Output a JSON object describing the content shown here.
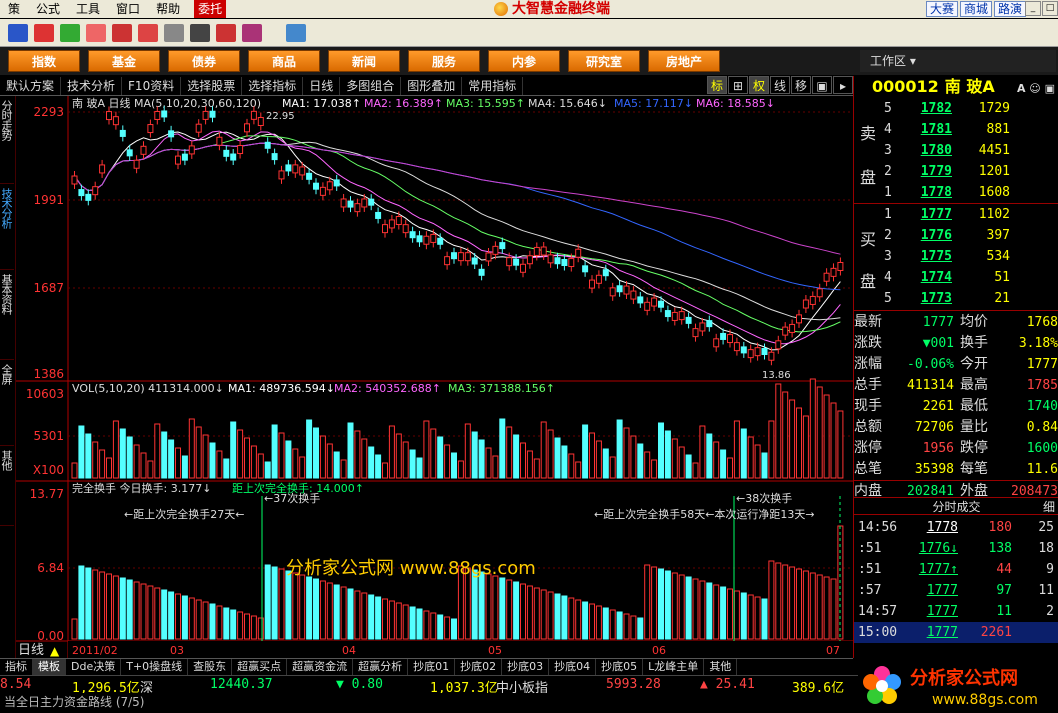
{
  "menu": [
    "策",
    "公式",
    "工具",
    "窗口",
    "帮助",
    "委托"
  ],
  "app_title": "大智慧金融终端",
  "top_right": [
    "大赛",
    "商城",
    "路演"
  ],
  "nav": [
    "指数",
    "基金",
    "债券",
    "商品",
    "新闻",
    "服务",
    "内参",
    "研究室",
    "房地产"
  ],
  "workarea": "工作区",
  "tabs": [
    "默认方案",
    "技术分析",
    "F10资料",
    "选择股票",
    "选择指标",
    "日线",
    "多图组合",
    "图形叠加",
    "常用指标"
  ],
  "tab_right": [
    "标",
    "⊞",
    "权",
    "线",
    "移",
    "▣",
    "▸"
  ],
  "left_tabs": [
    "分时走势",
    "技术分析",
    "基本资料",
    "全屏",
    "其他"
  ],
  "chart": {
    "header": "南  玻A 日线  MA(5,10,20,30,60,120)",
    "ma1": "MA1: 17.038↑",
    "ma2": "MA2: 16.389↑",
    "ma3": "MA3: 15.595↑",
    "ma4": "MA4: 15.646↓",
    "ma5": "MA5: 17.117↓",
    "ma6": "MA6: 18.585↓",
    "hi_label": "22.95",
    "lo_label": "13.86",
    "y_labels": [
      "2293",
      "1991",
      "1687",
      "1386"
    ],
    "vol_header": "VOL(5,10,20)  411314.000↓",
    "vol_ma1": "MA1: 489736.594↓",
    "vol_ma2": "MA2: 540352.688↑",
    "vol_ma3": "MA3: 371388.156↑",
    "vol_y": [
      "10603",
      "5301",
      "X100"
    ],
    "hs_header": "完全换手  今日换手: 3.177↓",
    "hs_last": "距上次完全换手: 14.000↑",
    "hs_y": [
      "13.77",
      "6.84",
      "0.00"
    ],
    "ann1": "←距上次完全换手27天←",
    "ann2": "←37次换手",
    "ann3": "←38次换手",
    "ann4": "←距上次完全换手58天←本次运行净距13天→",
    "watermark": "分析家公式网  www.88gs.com",
    "x_labels": [
      "2011/02",
      "03",
      "04",
      "05",
      "06",
      "07"
    ],
    "footer": "日线"
  },
  "chart_data": {
    "type": "candlestick",
    "title": "南玻A 日线",
    "ylim": [
      13.86,
      22.93
    ],
    "ma_last": {
      "MA1": 17.038,
      "MA2": 16.389,
      "MA3": 15.595,
      "MA4": 15.646,
      "MA5": 17.117,
      "MA6": 18.585
    },
    "high": 22.95,
    "low": 13.86,
    "volume_last": 411314.0,
    "turnover_last": 3.177,
    "days_since_full_turnover": 14
  },
  "right": {
    "code": "000012",
    "name": "南  玻A",
    "sell_label": "卖盘",
    "buy_label": "买盘",
    "sell": [
      {
        "lv": "5",
        "price": "1782",
        "vol": "1729"
      },
      {
        "lv": "4",
        "price": "1781",
        "vol": "881"
      },
      {
        "lv": "3",
        "price": "1780",
        "vol": "4451"
      },
      {
        "lv": "2",
        "price": "1779",
        "vol": "1201"
      },
      {
        "lv": "1",
        "price": "1778",
        "vol": "1608"
      }
    ],
    "buy": [
      {
        "lv": "1",
        "price": "1777",
        "vol": "1102"
      },
      {
        "lv": "2",
        "price": "1776",
        "vol": "397"
      },
      {
        "lv": "3",
        "price": "1775",
        "vol": "534"
      },
      {
        "lv": "4",
        "price": "1774",
        "vol": "51"
      },
      {
        "lv": "5",
        "price": "1773",
        "vol": "21"
      }
    ],
    "quote": [
      {
        "l1": "最新",
        "v1": "1777",
        "c1": "#00ff66",
        "l2": "均价",
        "v2": "1768",
        "c2": "#ffff00"
      },
      {
        "l1": "涨跌",
        "v1": "▼001",
        "c1": "#00ff66",
        "l2": "换手",
        "v2": "3.18%",
        "c2": "#ffff00"
      },
      {
        "l1": "涨幅",
        "v1": "-0.06%",
        "c1": "#00ff66",
        "l2": "今开",
        "v2": "1777",
        "c2": "#ffff00"
      },
      {
        "l1": "总手",
        "v1": "411314",
        "c1": "#ffff00",
        "l2": "最高",
        "v2": "1785",
        "c2": "#ff4444"
      },
      {
        "l1": "现手",
        "v1": "2261",
        "c1": "#ffff00",
        "l2": "最低",
        "v2": "1740",
        "c2": "#00ff66"
      },
      {
        "l1": "总额",
        "v1": "72706",
        "c1": "#ffff00",
        "l2": "量比",
        "v2": "0.84",
        "c2": "#ffff00"
      },
      {
        "l1": "涨停",
        "v1": "1956",
        "c1": "#ff4444",
        "l2": "跌停",
        "v2": "1600",
        "c2": "#00ff66"
      },
      {
        "l1": "总笔",
        "v1": "35398",
        "c1": "#ffff00",
        "l2": "每笔",
        "v2": "11.6",
        "c2": "#ffff00"
      },
      {
        "l1": "内盘",
        "v1": "202841",
        "c1": "#00ff66",
        "l2": "外盘",
        "v2": "208473",
        "c2": "#ff4444"
      }
    ],
    "ticks_title": "分时成交",
    "ticks_tab": "细",
    "ticks": [
      {
        "t": "14:56",
        "p": "1778",
        "pc": "#ffffff",
        "v": "180",
        "vc": "#ff4444",
        "n": "25"
      },
      {
        "t": ":51",
        "p": "1776↓",
        "pc": "#00ff66",
        "v": "138",
        "vc": "#00ff66",
        "n": "18"
      },
      {
        "t": ":51",
        "p": "1777↑",
        "pc": "#00ff66",
        "v": "44",
        "vc": "#ff4444",
        "n": "9"
      },
      {
        "t": ":57",
        "p": "1777",
        "pc": "#00ff66",
        "v": "97",
        "vc": "#00ff66",
        "n": "11"
      },
      {
        "t": "14:57",
        "p": "1777",
        "pc": "#00ff66",
        "v": "11",
        "vc": "#00ff66",
        "n": "2"
      },
      {
        "t": "15:00",
        "p": "1777",
        "pc": "#00ff66",
        "v": "2261",
        "vc": "#ff4444",
        "n": ""
      }
    ]
  },
  "bottom_tabs": [
    "指标",
    "模板",
    "Dde决策",
    "T+0操盘线",
    "查股东",
    "超赢买点",
    "超赢资金流",
    "超赢分析",
    "抄底01",
    "抄底02",
    "抄底03",
    "抄底04",
    "抄底05",
    "L龙峰主单",
    "其他"
  ],
  "status": {
    "s1": "8.54",
    "s2": "1,296.5亿",
    "s3": "深",
    "s4": "12440.37",
    "s5": "▼ 0.80",
    "s6": "1,037.3亿",
    "s7": "中小板指",
    "s8": "5993.28",
    "s9": "▲ 25.41",
    "s10": "389.6亿"
  },
  "status2": "当全日主力资金路线 (7/5)",
  "brand": "分析家公式网",
  "brand_url": "www.88gs.com"
}
